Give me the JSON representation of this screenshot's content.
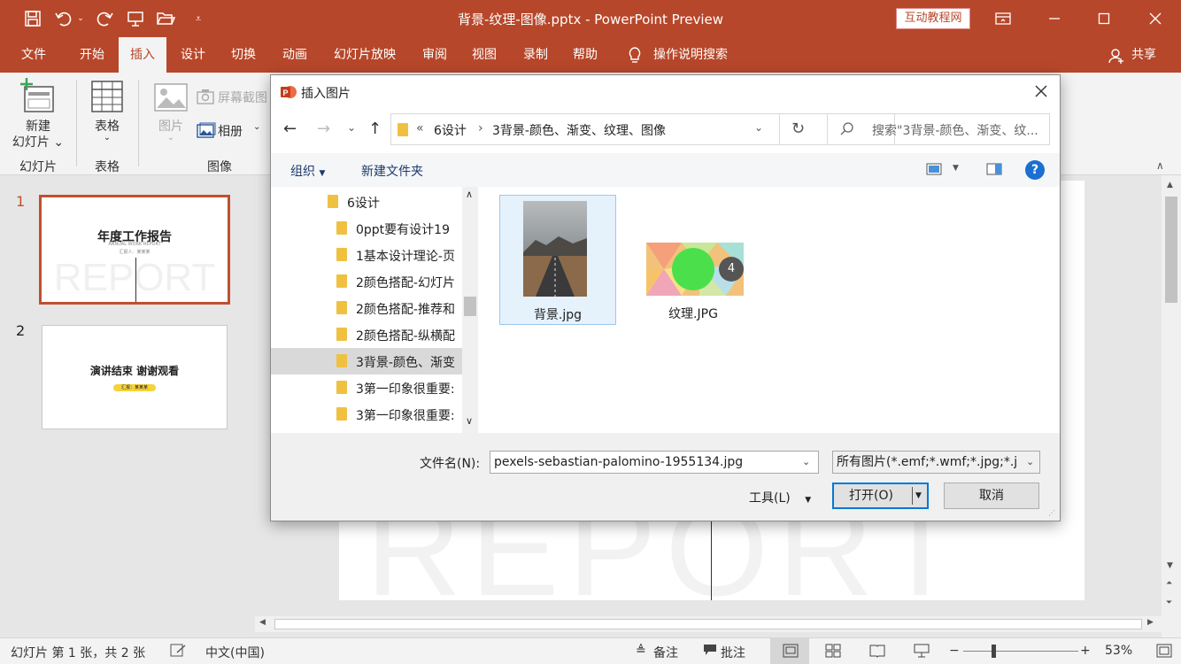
{
  "window": {
    "title": "背景-纹理-图像.pptx  -  PowerPoint Preview",
    "badge": "互动教程网",
    "accent": "#b7472a"
  },
  "tabs": [
    "文件",
    "开始",
    "插入",
    "设计",
    "切换",
    "动画",
    "幻灯片放映",
    "审阅",
    "视图",
    "录制",
    "帮助"
  ],
  "active_tab": "插入",
  "tell_me": "操作说明搜索",
  "share": "共享",
  "ribbon": {
    "new_slide": "新建\n幻灯片",
    "new_slide_line1": "新建",
    "new_slide_line2": "幻灯片",
    "group_slides": "幻灯片",
    "table": "表格",
    "group_table": "表格",
    "picture": "图片",
    "screenshot": "屏幕截图",
    "album": "相册",
    "group_image": "图像"
  },
  "slides": [
    {
      "num": "1",
      "title": "年度工作报告",
      "subtitle": "ANNUAL WORK REPORT",
      "sub2": "汇报人：某某某",
      "bg_text": "REPORT"
    },
    {
      "num": "2",
      "title": "演讲结束 谢谢观看",
      "pill": "汇报：某某某"
    }
  ],
  "main_bg_text": "REPORT",
  "status": {
    "slide_info": "幻灯片 第 1 张，共 2 张",
    "lang": "中文(中国)",
    "notes": "备注",
    "comments": "批注",
    "zoom": "53%"
  },
  "dialog": {
    "title": "插入图片",
    "breadcrumb": [
      "6设计",
      "3背景-颜色、渐变、纹理、图像"
    ],
    "breadcrumb_prefix": "«",
    "search_placeholder": "搜索\"3背景-颜色、渐变、纹...",
    "organize": "组织",
    "new_folder": "新建文件夹",
    "tree": [
      {
        "label": "6设计",
        "level": 0
      },
      {
        "label": "0ppt要有设计19",
        "level": 1
      },
      {
        "label": "1基本设计理论-页",
        "level": 1
      },
      {
        "label": "2颜色搭配-幻灯片",
        "level": 1
      },
      {
        "label": "2颜色搭配-推荐和",
        "level": 1
      },
      {
        "label": "2颜色搭配-纵横配",
        "level": 1
      },
      {
        "label": "3背景-颜色、渐变",
        "level": 1,
        "selected": true
      },
      {
        "label": "3第一印象很重要:",
        "level": 1
      },
      {
        "label": "3第一印象很重要:",
        "level": 1
      }
    ],
    "files": [
      {
        "name": "背景.jpg",
        "selected": true
      },
      {
        "name": "纹理.JPG",
        "overlay": "4"
      }
    ],
    "filename_label": "文件名(N):",
    "filename_value": "pexels-sebastian-palomino-1955134.jpg",
    "filetype_value": "所有图片(*.emf;*.wmf;*.jpg;*.j",
    "tools": "工具(L)",
    "open": "打开(O)",
    "cancel": "取消"
  }
}
